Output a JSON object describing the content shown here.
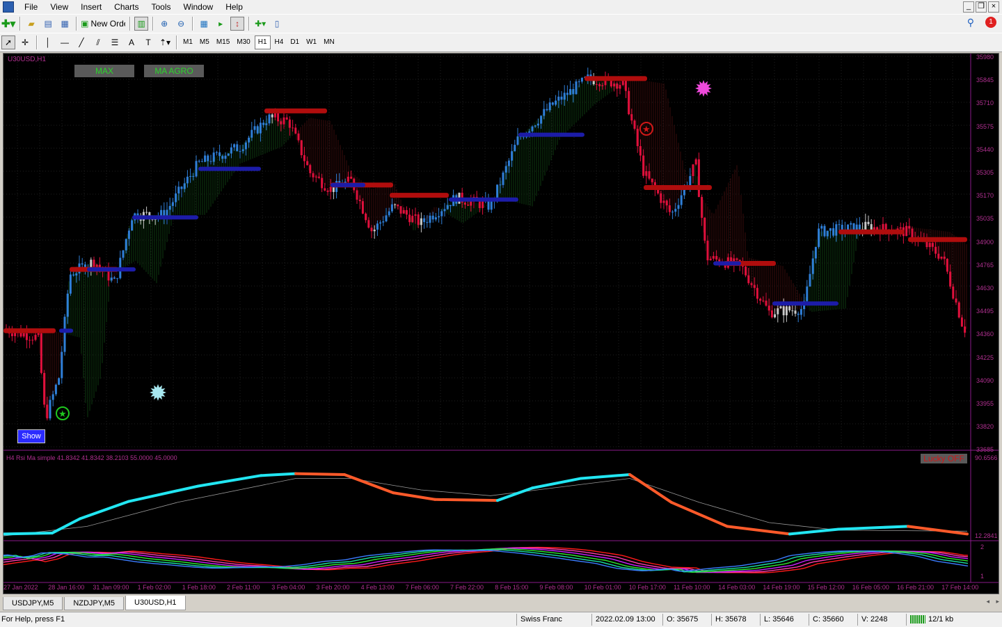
{
  "menu": [
    "File",
    "View",
    "Insert",
    "Charts",
    "Tools",
    "Window",
    "Help"
  ],
  "toolbar": {
    "new_order_label": "New Order",
    "notification_count": "1"
  },
  "timeframes": [
    "M1",
    "M5",
    "M15",
    "M30",
    "H1",
    "H4",
    "D1",
    "W1",
    "MN"
  ],
  "active_timeframe": "H1",
  "chart": {
    "title": "U30USD,H1",
    "btn_max": "MAX",
    "btn_ma_agro": "MA AGRO",
    "show_button": "Show",
    "price_labels": [
      "35980",
      "35845",
      "35710",
      "35575",
      "35440",
      "35305",
      "35170",
      "35035",
      "34900",
      "34765",
      "34630",
      "34495",
      "34360",
      "34225",
      "34090",
      "33955",
      "33820",
      "33685"
    ],
    "indicator_label": "H4 Rsi Ma simple 41.8342 41.8342 38.2103 55.0000 45.0000",
    "lucky_button": "Lucky OFF",
    "ind_axis_top": "90.6566",
    "ind_axis_bottom": "12.2841",
    "ind2_axis_top": "2",
    "ind2_axis_bottom": "1",
    "time_labels": [
      "27 Jan 2022",
      "28 Jan 16:00",
      "31 Jan 09:00",
      "1 Feb 02:00",
      "1 Feb 18:00",
      "2 Feb 11:00",
      "3 Feb 04:00",
      "3 Feb 20:00",
      "4 Feb 13:00",
      "7 Feb 06:00",
      "7 Feb 22:00",
      "8 Feb 15:00",
      "9 Feb 08:00",
      "10 Feb 01:00",
      "10 Feb 17:00",
      "11 Feb 10:00",
      "14 Feb 03:00",
      "14 Feb 19:00",
      "15 Feb 12:00",
      "16 Feb 05:00",
      "16 Feb 21:00",
      "17 Feb 14:00"
    ]
  },
  "tabs": [
    "USDJPY,M5",
    "NZDJPY,M5",
    "U30USD,H1"
  ],
  "active_tab": "U30USD,H1",
  "status": {
    "help": "For Help, press F1",
    "profile": "Swiss Franc",
    "datetime": "2022.02.09 13:00",
    "open": "O: 35675",
    "high": "H: 35678",
    "low": "L: 35646",
    "close": "C: 35660",
    "volume": "V: 2248",
    "traffic": "12/1 kb"
  },
  "chart_data": {
    "type": "candlestick",
    "symbol": "U30USD",
    "timeframe": "H1",
    "ylim": [
      33685,
      35980
    ],
    "close_path": [
      [
        0,
        34380
      ],
      [
        50,
        34330
      ],
      [
        60,
        33850
      ],
      [
        80,
        34100
      ],
      [
        95,
        34700
      ],
      [
        130,
        34780
      ],
      [
        160,
        34650
      ],
      [
        185,
        35050
      ],
      [
        230,
        35050
      ],
      [
        280,
        35350
      ],
      [
        340,
        35450
      ],
      [
        380,
        35620
      ],
      [
        410,
        35600
      ],
      [
        440,
        35300
      ],
      [
        470,
        35200
      ],
      [
        500,
        35250
      ],
      [
        530,
        34950
      ],
      [
        560,
        35100
      ],
      [
        600,
        35000
      ],
      [
        650,
        35150
      ],
      [
        700,
        35100
      ],
      [
        740,
        35500
      ],
      [
        790,
        35700
      ],
      [
        840,
        35850
      ],
      [
        890,
        35820
      ],
      [
        920,
        35300
      ],
      [
        960,
        35050
      ],
      [
        995,
        35350
      ],
      [
        1010,
        34800
      ],
      [
        1060,
        34750
      ],
      [
        1100,
        34480
      ],
      [
        1150,
        34500
      ],
      [
        1170,
        34950
      ],
      [
        1240,
        34980
      ],
      [
        1300,
        34950
      ],
      [
        1350,
        34800
      ],
      [
        1380,
        34380
      ]
    ],
    "resistance_levels": [
      {
        "from": 0,
        "to": 75,
        "price": 34370
      },
      {
        "from": 95,
        "to": 165,
        "price": 34730
      },
      {
        "from": 375,
        "to": 465,
        "price": 35660
      },
      {
        "from": 470,
        "to": 560,
        "price": 35225
      },
      {
        "from": 555,
        "to": 640,
        "price": 35165
      },
      {
        "from": 835,
        "to": 925,
        "price": 35850
      },
      {
        "from": 920,
        "to": 1018,
        "price": 35210
      },
      {
        "from": 1035,
        "to": 1110,
        "price": 34765
      },
      {
        "from": 1200,
        "to": 1295,
        "price": 34950
      },
      {
        "from": 1300,
        "to": 1385,
        "price": 34905
      }
    ],
    "support_levels": [
      {
        "from": 80,
        "to": 100,
        "price": 34370
      },
      {
        "from": 120,
        "to": 190,
        "price": 34730
      },
      {
        "from": 185,
        "to": 280,
        "price": 35035
      },
      {
        "from": 280,
        "to": 370,
        "price": 35320
      },
      {
        "from": 470,
        "to": 520,
        "price": 35225
      },
      {
        "from": 640,
        "to": 740,
        "price": 35140
      },
      {
        "from": 740,
        "to": 835,
        "price": 35520
      },
      {
        "from": 1020,
        "to": 1060,
        "price": 34765
      },
      {
        "from": 1105,
        "to": 1200,
        "price": 34530
      }
    ],
    "rsi_ylim": [
      12.2841,
      90.6566
    ],
    "rsi_path": [
      [
        0,
        12
      ],
      [
        70,
        13
      ],
      [
        110,
        28
      ],
      [
        180,
        46
      ],
      [
        280,
        62
      ],
      [
        370,
        73
      ],
      [
        420,
        75
      ],
      [
        490,
        74
      ],
      [
        560,
        55
      ],
      [
        620,
        48
      ],
      [
        710,
        47
      ],
      [
        760,
        60
      ],
      [
        830,
        70
      ],
      [
        900,
        74
      ],
      [
        960,
        45
      ],
      [
        1040,
        20
      ],
      [
        1130,
        12
      ],
      [
        1200,
        17
      ],
      [
        1300,
        20
      ],
      [
        1385,
        12
      ]
    ],
    "rsi_signal_path": [
      [
        0,
        10
      ],
      [
        120,
        20
      ],
      [
        250,
        45
      ],
      [
        420,
        70
      ],
      [
        500,
        70
      ],
      [
        600,
        58
      ],
      [
        700,
        52
      ],
      [
        900,
        70
      ],
      [
        1000,
        45
      ],
      [
        1100,
        24
      ],
      [
        1200,
        16
      ],
      [
        1385,
        15
      ]
    ]
  }
}
